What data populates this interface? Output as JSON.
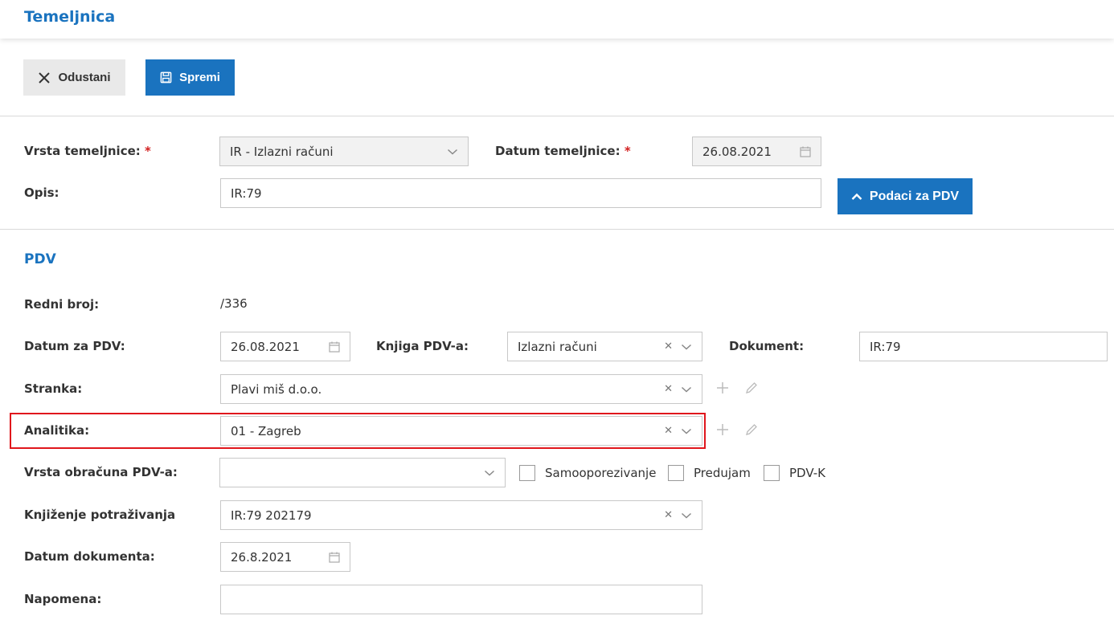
{
  "header": {
    "title": "Temeljnica"
  },
  "toolbar": {
    "cancel_label": "Odustani",
    "save_label": "Spremi"
  },
  "form": {
    "vrsta_label": "Vrsta temeljnice:",
    "vrsta_value": "IR - Izlazni računi",
    "datum_label": "Datum temeljnice:",
    "datum_value": "26.08.2021",
    "opis_label": "Opis:",
    "opis_value": "IR:79",
    "pdv_button": "Podaci za PDV",
    "required_mark": "*"
  },
  "pdv": {
    "title": "PDV",
    "redni_label": "Redni broj:",
    "redni_value": "/336",
    "datum_pdv_label": "Datum za PDV:",
    "datum_pdv_value": "26.08.2021",
    "knjiga_label": "Knjiga PDV-a:",
    "knjiga_value": "Izlazni računi",
    "dokument_label": "Dokument:",
    "dokument_value": "IR:79",
    "stranka_label": "Stranka:",
    "stranka_value": "Plavi miš d.o.o.",
    "analitika_label": "Analitika:",
    "analitika_value": "01 - Zagreb",
    "vrsta_obracuna_label": "Vrsta obračuna PDV-a:",
    "vrsta_obracuna_value": "",
    "samooporezivanje_label": "Samooporezivanje",
    "predujam_label": "Predujam",
    "pdvk_label": "PDV-K",
    "knjizenje_label": "Knjiženje potraživanja",
    "knjizenje_value": "IR:79 202179",
    "datum_dok_label": "Datum dokumenta:",
    "datum_dok_value": "26.8.2021",
    "napomena_label": "Napomena:",
    "napomena_value": ""
  },
  "colors": {
    "accent": "#1a73bf",
    "highlight": "#e0161c",
    "required": "#d21f1f"
  },
  "icons": [
    "close-icon",
    "save-icon",
    "chevron-up-icon",
    "chevron-down-icon",
    "calendar-icon",
    "clear-icon",
    "plus-icon",
    "pencil-icon"
  ]
}
